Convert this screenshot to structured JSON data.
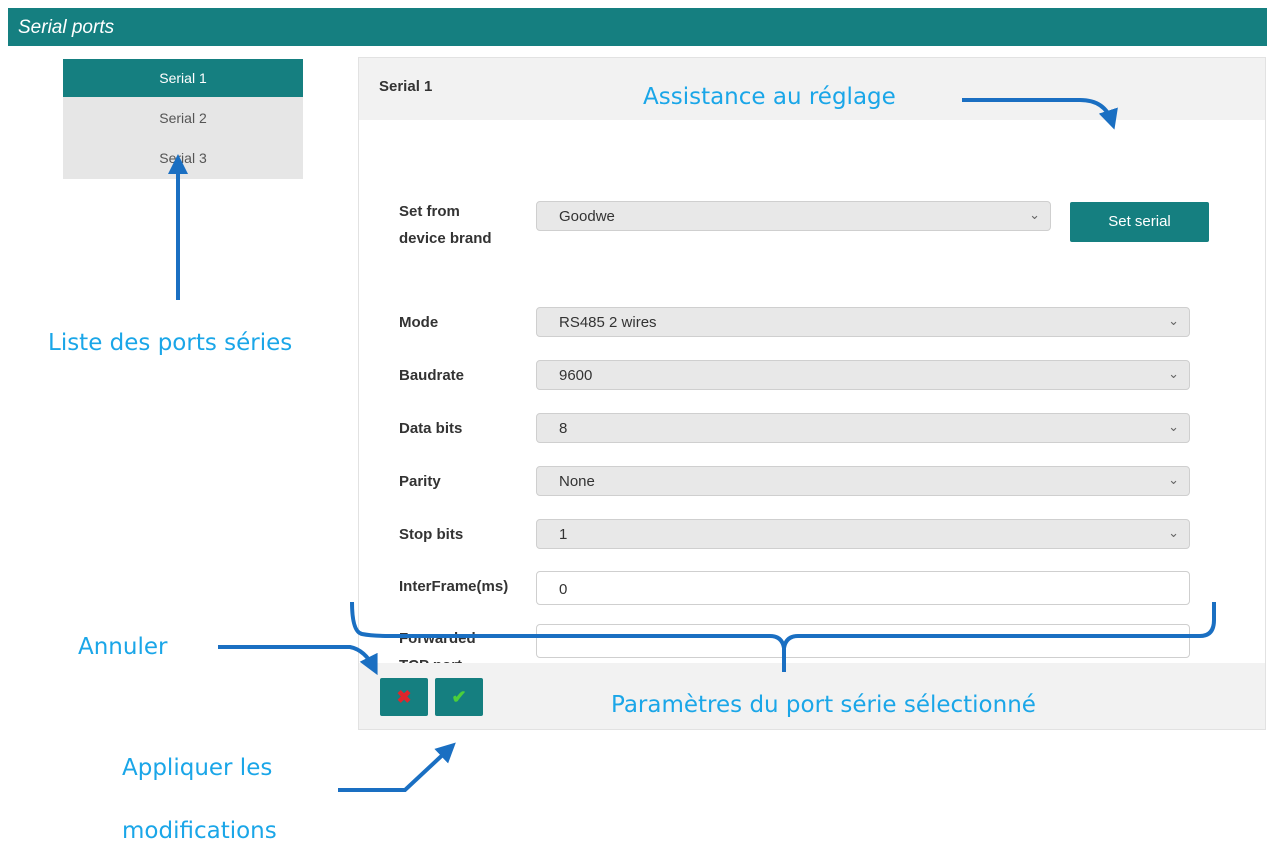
{
  "window": {
    "title": "Serial ports"
  },
  "ports": [
    {
      "label": "Serial 1",
      "active": true
    },
    {
      "label": "Serial 2",
      "active": false
    },
    {
      "label": "Serial 3",
      "active": false
    }
  ],
  "panel": {
    "title": "Serial 1",
    "brand": {
      "label": "Set from device brand",
      "value": "Goodwe",
      "button": "Set serial"
    },
    "fields": [
      {
        "label": "Mode",
        "value": "RS485 2 wires"
      },
      {
        "label": "Baudrate",
        "value": "9600"
      },
      {
        "label": "Data bits",
        "value": "8"
      },
      {
        "label": "Parity",
        "value": "None"
      },
      {
        "label": "Stop bits",
        "value": "1"
      }
    ],
    "interframe": {
      "label": "InterFrame(ms)",
      "value": "0"
    },
    "forwarded": {
      "label": "Forwarded TCP port",
      "value": ""
    },
    "buttons": {
      "cancel": "✖",
      "apply": "✔"
    }
  },
  "annotations": {
    "assistance": "Assistance au réglage",
    "port_list": "Liste des ports séries",
    "cancel": "Annuler",
    "params": "Paramètres du port série sélectionné",
    "apply_line1": "Appliquer les",
    "apply_line2": "modifications"
  },
  "colors": {
    "accent": "#157f80",
    "annotation": "#1aa6e8",
    "arrow": "#1a6fc2",
    "cancel_icon": "#e0262b",
    "apply_icon": "#4ccf3a"
  },
  "icons": {
    "dropdown": "chevron-down-icon",
    "cancel": "close-icon",
    "apply": "check-icon"
  }
}
